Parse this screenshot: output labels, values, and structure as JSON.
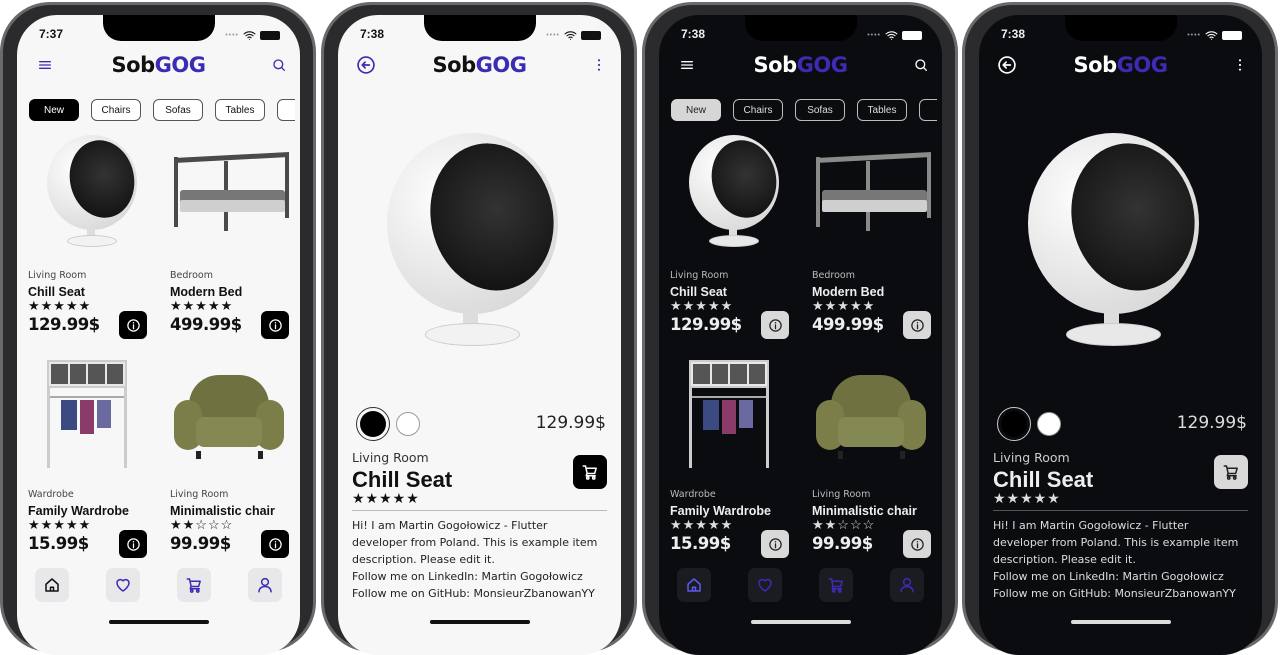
{
  "brand": {
    "part1": "Sob",
    "part2": "GOG"
  },
  "colors": {
    "accent": "#3b2cb3",
    "light_bg": "#f7f7f7",
    "dark_bg": "#0b0c10",
    "armchair": "#6f7240"
  },
  "phones": [
    {
      "time": "7:37",
      "theme": "light",
      "screen": "home"
    },
    {
      "time": "7:38",
      "theme": "light",
      "screen": "detail"
    },
    {
      "time": "7:38",
      "theme": "dark",
      "screen": "home"
    },
    {
      "time": "7:38",
      "theme": "dark",
      "screen": "detail"
    }
  ],
  "categories": [
    {
      "label": "New",
      "selected": true
    },
    {
      "label": "Chairs",
      "selected": false
    },
    {
      "label": "Sofas",
      "selected": false
    },
    {
      "label": "Tables",
      "selected": false
    },
    {
      "label": "",
      "selected": false
    }
  ],
  "products": [
    {
      "category": "Living Room",
      "name": "Chill Seat",
      "rating": 5,
      "stars": "★★★★★",
      "price": "129.99$",
      "image": "ball-chair"
    },
    {
      "category": "Bedroom",
      "name": "Modern Bed",
      "rating": 5,
      "stars": "★★★★★",
      "price": "499.99$",
      "image": "canopy-bed"
    },
    {
      "category": "Wardrobe",
      "name": "Family Wardrobe",
      "rating": 5,
      "stars": "★★★★★",
      "price": "15.99$",
      "image": "wardrobe"
    },
    {
      "category": "Living Room",
      "name": "Minimalistic chair",
      "rating": 2,
      "stars": "★★☆☆☆",
      "price": "99.99$",
      "image": "armchair"
    }
  ],
  "nav": [
    {
      "icon": "home-icon",
      "label": "home"
    },
    {
      "icon": "heart-icon",
      "label": "favorites"
    },
    {
      "icon": "cart-icon",
      "label": "cart"
    },
    {
      "icon": "user-icon",
      "label": "profile"
    }
  ],
  "detail": {
    "category": "Living Room",
    "name": "Chill Seat",
    "rating": 5,
    "stars": "★★★★★",
    "price": "129.99$",
    "color_options": [
      "#000000",
      "#ffffff"
    ],
    "selected_color": 0,
    "description": [
      "Hi! I am Martin Gogołowicz - Flutter",
      "developer from Poland. This is example item",
      "description. Please edit it.",
      "Follow me on LinkedIn: Martin Gogołowicz",
      "Follow me on GitHub: MonsieurZbanowanYY"
    ]
  }
}
